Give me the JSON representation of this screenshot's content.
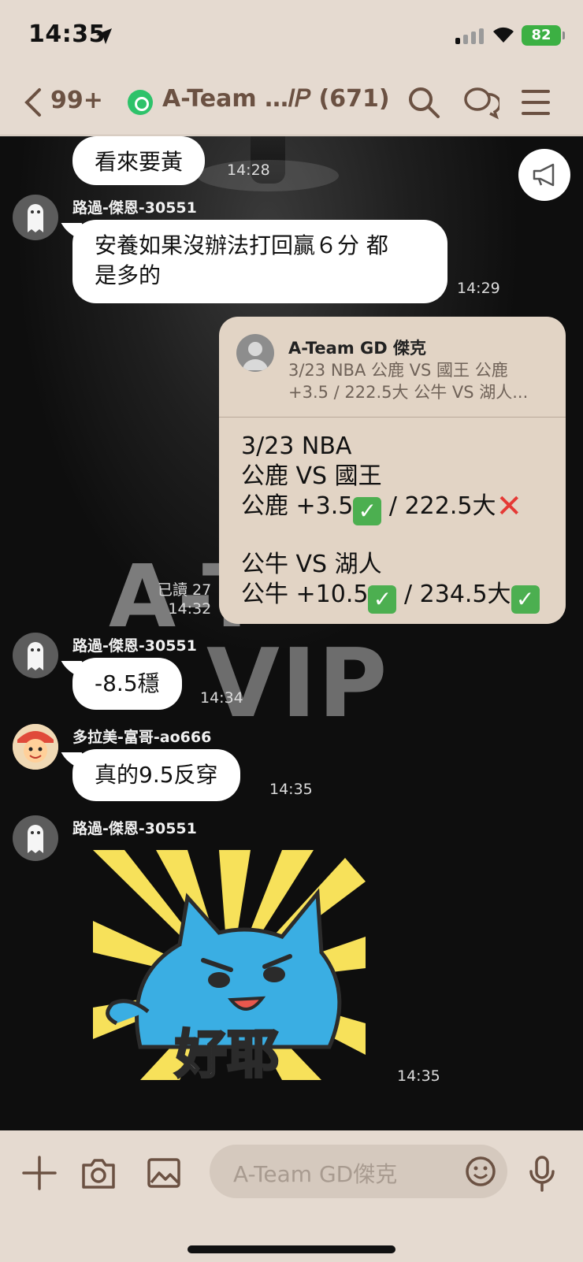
{
  "status_bar": {
    "time": "14:35",
    "battery": "82"
  },
  "header": {
    "unread_count": "99+",
    "title": "A-Team …𝐼𝑃 (671)"
  },
  "messages": [
    {
      "text": "看來要黃",
      "time": "14:28"
    },
    {
      "sender": "路過-傑恩-30551",
      "text_line1": "安養如果沒辦法打回贏６分 都",
      "text_line2": "是多的",
      "time": "14:29"
    },
    {
      "sender": "路過-傑恩-30551",
      "text": "-8.5穩",
      "time": "14:34"
    },
    {
      "sender": "多拉美-富哥-ao666",
      "text": "真的9.5反穿",
      "time": "14:35"
    },
    {
      "sender": "路過-傑恩-30551",
      "sticker_text": "好耶",
      "time": "14:35"
    }
  ],
  "forward_card": {
    "name": "A-Team GD 傑克",
    "preview_line1": "3/23 NBA 公鹿 VS 國王 公鹿",
    "preview_line2": "+3.5 / 222.5大 公牛 VS 湖人...",
    "body_line1": "3/23 NBA",
    "body_line2": "公鹿 VS 國王",
    "body_line3a": "公鹿 +3.5",
    "body_line3b": " / 222.5大",
    "body_line4": "公牛 VS 湖人",
    "body_line5a": "公牛 +10.5",
    "body_line5b": " / 234.5大",
    "read_label": "已讀 27",
    "time": "14:32"
  },
  "watermark": {
    "letters": "A-T",
    "vip": "VIP"
  },
  "input": {
    "placeholder": "A-Team GD傑克"
  },
  "colors": {
    "brand_brown": "#6b5142",
    "background": "#e5dad0",
    "check_green": "#4caf50",
    "cross_red": "#e53935"
  }
}
